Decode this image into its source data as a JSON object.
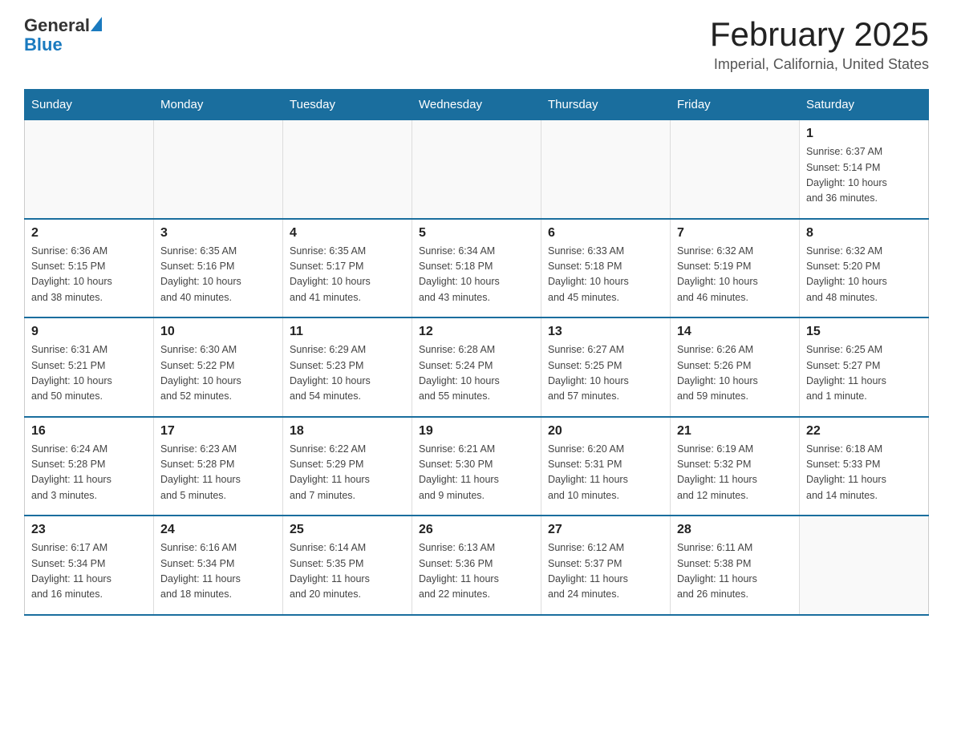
{
  "header": {
    "logo_general": "General",
    "logo_blue": "Blue",
    "title": "February 2025",
    "subtitle": "Imperial, California, United States"
  },
  "calendar": {
    "days_of_week": [
      "Sunday",
      "Monday",
      "Tuesday",
      "Wednesday",
      "Thursday",
      "Friday",
      "Saturday"
    ],
    "weeks": [
      {
        "cells": [
          {
            "day": "",
            "info": "",
            "empty": true
          },
          {
            "day": "",
            "info": "",
            "empty": true
          },
          {
            "day": "",
            "info": "",
            "empty": true
          },
          {
            "day": "",
            "info": "",
            "empty": true
          },
          {
            "day": "",
            "info": "",
            "empty": true
          },
          {
            "day": "",
            "info": "",
            "empty": true
          },
          {
            "day": "1",
            "info": "Sunrise: 6:37 AM\nSunset: 5:14 PM\nDaylight: 10 hours\nand 36 minutes.",
            "empty": false
          }
        ]
      },
      {
        "cells": [
          {
            "day": "2",
            "info": "Sunrise: 6:36 AM\nSunset: 5:15 PM\nDaylight: 10 hours\nand 38 minutes.",
            "empty": false
          },
          {
            "day": "3",
            "info": "Sunrise: 6:35 AM\nSunset: 5:16 PM\nDaylight: 10 hours\nand 40 minutes.",
            "empty": false
          },
          {
            "day": "4",
            "info": "Sunrise: 6:35 AM\nSunset: 5:17 PM\nDaylight: 10 hours\nand 41 minutes.",
            "empty": false
          },
          {
            "day": "5",
            "info": "Sunrise: 6:34 AM\nSunset: 5:18 PM\nDaylight: 10 hours\nand 43 minutes.",
            "empty": false
          },
          {
            "day": "6",
            "info": "Sunrise: 6:33 AM\nSunset: 5:18 PM\nDaylight: 10 hours\nand 45 minutes.",
            "empty": false
          },
          {
            "day": "7",
            "info": "Sunrise: 6:32 AM\nSunset: 5:19 PM\nDaylight: 10 hours\nand 46 minutes.",
            "empty": false
          },
          {
            "day": "8",
            "info": "Sunrise: 6:32 AM\nSunset: 5:20 PM\nDaylight: 10 hours\nand 48 minutes.",
            "empty": false
          }
        ]
      },
      {
        "cells": [
          {
            "day": "9",
            "info": "Sunrise: 6:31 AM\nSunset: 5:21 PM\nDaylight: 10 hours\nand 50 minutes.",
            "empty": false
          },
          {
            "day": "10",
            "info": "Sunrise: 6:30 AM\nSunset: 5:22 PM\nDaylight: 10 hours\nand 52 minutes.",
            "empty": false
          },
          {
            "day": "11",
            "info": "Sunrise: 6:29 AM\nSunset: 5:23 PM\nDaylight: 10 hours\nand 54 minutes.",
            "empty": false
          },
          {
            "day": "12",
            "info": "Sunrise: 6:28 AM\nSunset: 5:24 PM\nDaylight: 10 hours\nand 55 minutes.",
            "empty": false
          },
          {
            "day": "13",
            "info": "Sunrise: 6:27 AM\nSunset: 5:25 PM\nDaylight: 10 hours\nand 57 minutes.",
            "empty": false
          },
          {
            "day": "14",
            "info": "Sunrise: 6:26 AM\nSunset: 5:26 PM\nDaylight: 10 hours\nand 59 minutes.",
            "empty": false
          },
          {
            "day": "15",
            "info": "Sunrise: 6:25 AM\nSunset: 5:27 PM\nDaylight: 11 hours\nand 1 minute.",
            "empty": false
          }
        ]
      },
      {
        "cells": [
          {
            "day": "16",
            "info": "Sunrise: 6:24 AM\nSunset: 5:28 PM\nDaylight: 11 hours\nand 3 minutes.",
            "empty": false
          },
          {
            "day": "17",
            "info": "Sunrise: 6:23 AM\nSunset: 5:28 PM\nDaylight: 11 hours\nand 5 minutes.",
            "empty": false
          },
          {
            "day": "18",
            "info": "Sunrise: 6:22 AM\nSunset: 5:29 PM\nDaylight: 11 hours\nand 7 minutes.",
            "empty": false
          },
          {
            "day": "19",
            "info": "Sunrise: 6:21 AM\nSunset: 5:30 PM\nDaylight: 11 hours\nand 9 minutes.",
            "empty": false
          },
          {
            "day": "20",
            "info": "Sunrise: 6:20 AM\nSunset: 5:31 PM\nDaylight: 11 hours\nand 10 minutes.",
            "empty": false
          },
          {
            "day": "21",
            "info": "Sunrise: 6:19 AM\nSunset: 5:32 PM\nDaylight: 11 hours\nand 12 minutes.",
            "empty": false
          },
          {
            "day": "22",
            "info": "Sunrise: 6:18 AM\nSunset: 5:33 PM\nDaylight: 11 hours\nand 14 minutes.",
            "empty": false
          }
        ]
      },
      {
        "cells": [
          {
            "day": "23",
            "info": "Sunrise: 6:17 AM\nSunset: 5:34 PM\nDaylight: 11 hours\nand 16 minutes.",
            "empty": false
          },
          {
            "day": "24",
            "info": "Sunrise: 6:16 AM\nSunset: 5:34 PM\nDaylight: 11 hours\nand 18 minutes.",
            "empty": false
          },
          {
            "day": "25",
            "info": "Sunrise: 6:14 AM\nSunset: 5:35 PM\nDaylight: 11 hours\nand 20 minutes.",
            "empty": false
          },
          {
            "day": "26",
            "info": "Sunrise: 6:13 AM\nSunset: 5:36 PM\nDaylight: 11 hours\nand 22 minutes.",
            "empty": false
          },
          {
            "day": "27",
            "info": "Sunrise: 6:12 AM\nSunset: 5:37 PM\nDaylight: 11 hours\nand 24 minutes.",
            "empty": false
          },
          {
            "day": "28",
            "info": "Sunrise: 6:11 AM\nSunset: 5:38 PM\nDaylight: 11 hours\nand 26 minutes.",
            "empty": false
          },
          {
            "day": "",
            "info": "",
            "empty": true
          }
        ]
      }
    ]
  }
}
